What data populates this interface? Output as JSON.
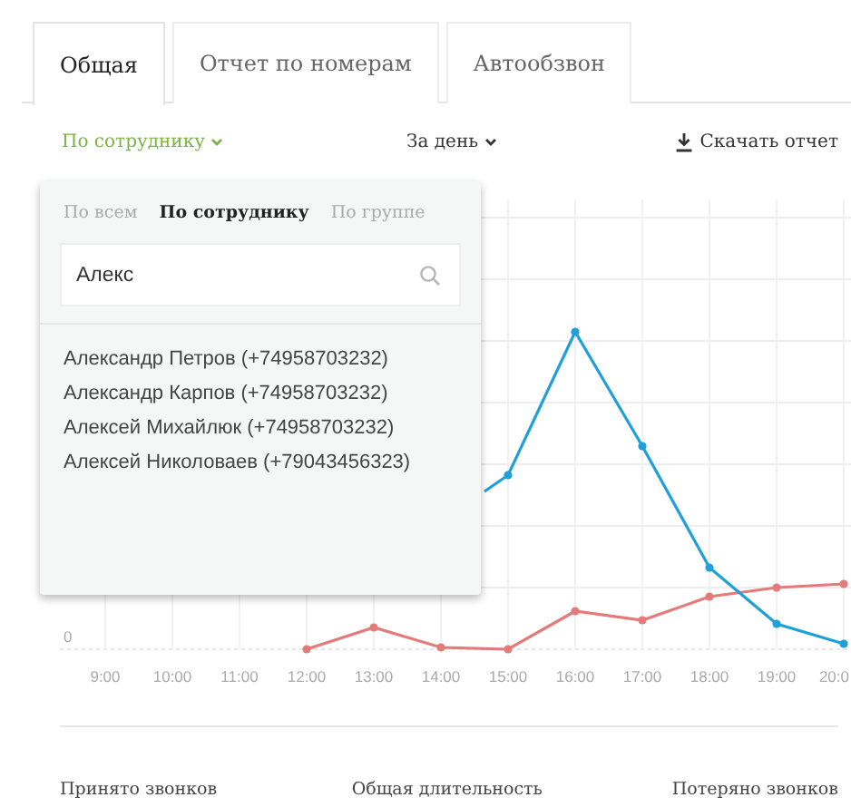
{
  "tabs": [
    {
      "label": "Общая",
      "selected": true
    },
    {
      "label": "Отчет по номерам",
      "selected": false
    },
    {
      "label": "Автообзвон",
      "selected": false
    }
  ],
  "toolbar": {
    "group_by": {
      "label": "По сотруднику"
    },
    "period": {
      "label": "За день"
    },
    "download": {
      "label": "Скачать отчет"
    }
  },
  "dropdown": {
    "modes": [
      {
        "label": "По всем",
        "selected": false
      },
      {
        "label": "По сотруднику",
        "selected": true
      },
      {
        "label": "По группе",
        "selected": false
      }
    ],
    "search": {
      "value": "Алекс"
    },
    "results": [
      "Александр Петров (+74958703232)",
      "Александр Карпов (+74958703232)",
      "Алексей Михайлюк (+74958703232)",
      "Алексей Николоваев (+79043456323)"
    ]
  },
  "chart": {
    "y_label": "0",
    "x_labels": [
      "9:00",
      "10:00",
      "11:00",
      "12:00",
      "13:00",
      "14:00",
      "15:00",
      "16:00",
      "17:00",
      "18:00",
      "19:00",
      "20:0"
    ]
  },
  "summary": [
    "Принято звонков",
    "Общая длительность",
    "Потеряно звонков"
  ]
}
